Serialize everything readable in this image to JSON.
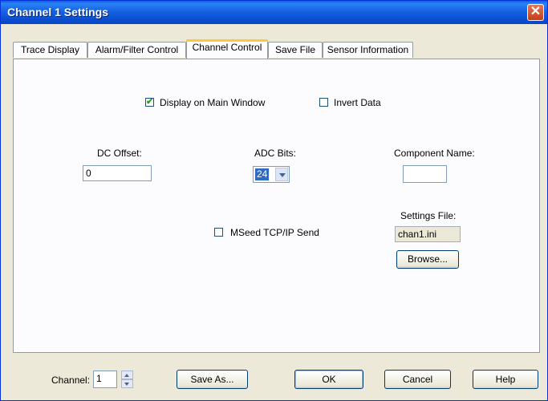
{
  "window": {
    "title": "Channel 1 Settings",
    "close_glyph": "✕"
  },
  "tabs": [
    {
      "label": "Trace Display",
      "active": false
    },
    {
      "label": "Alarm/Filter Control",
      "active": false
    },
    {
      "label": "Channel Control",
      "active": true
    },
    {
      "label": "Save File",
      "active": false
    },
    {
      "label": "Sensor Information",
      "active": false
    }
  ],
  "channel_control": {
    "display_on_main": {
      "label": "Display on Main Window",
      "checked": true
    },
    "invert_data": {
      "label": "Invert Data",
      "checked": false
    },
    "dc_offset": {
      "label": "DC Offset:",
      "value": "0"
    },
    "adc_bits": {
      "label": "ADC Bits:",
      "value": "24"
    },
    "component_name": {
      "label": "Component Name:",
      "value": ""
    },
    "mseed_send": {
      "label": "MSeed TCP/IP Send",
      "checked": false
    },
    "settings_file": {
      "label": "Settings File:",
      "value": "chan1.ini",
      "browse_label": "Browse..."
    }
  },
  "footer": {
    "channel_label": "Channel:",
    "channel_value": "1",
    "save_as_label": "Save As...",
    "ok_label": "OK",
    "cancel_label": "Cancel",
    "help_label": "Help"
  },
  "check_glyph": "✔"
}
